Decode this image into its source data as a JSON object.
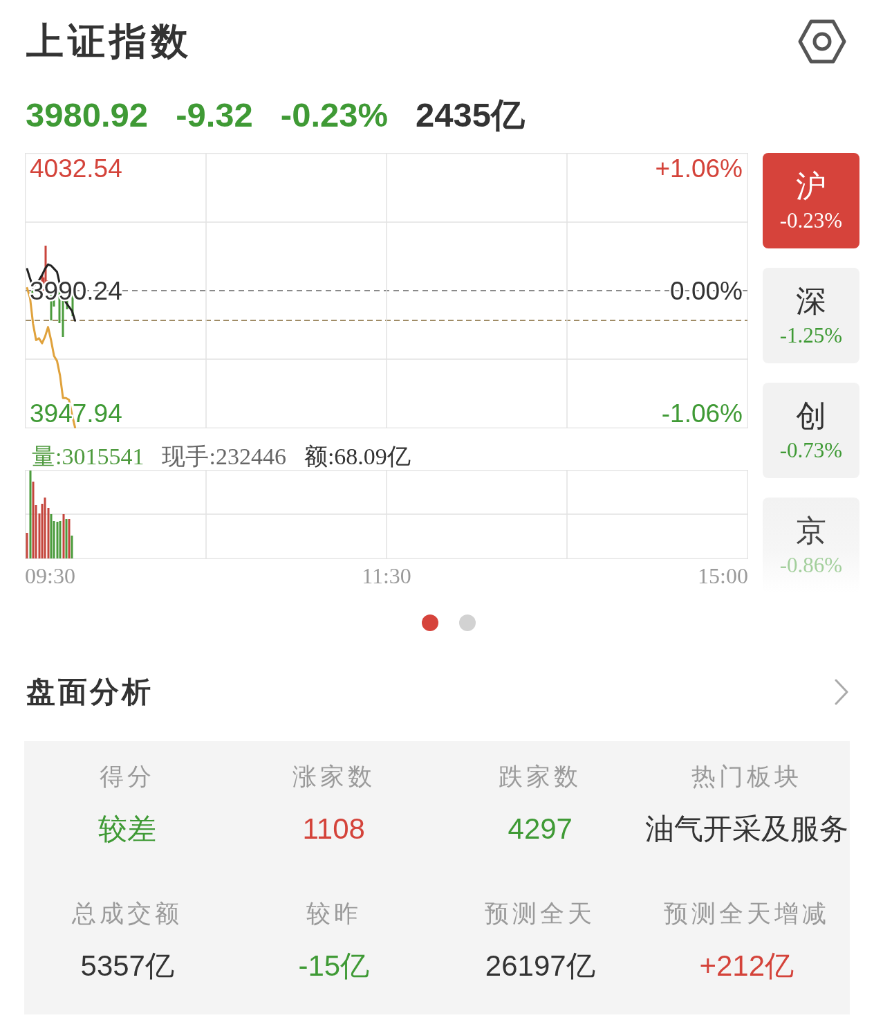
{
  "header": {
    "title": "上证指数"
  },
  "quote": [
    {
      "text": "3980.92",
      "color": "#3f9a35"
    },
    {
      "text": "-9.32",
      "color": "#3f9a35"
    },
    {
      "text": "-0.23%",
      "color": "#3f9a35"
    },
    {
      "text": "2435亿",
      "color": "#333333"
    }
  ],
  "price_chart": {
    "chart_data": {
      "type": "line",
      "categories": [
        null,
        null,
        null,
        null,
        null,
        null,
        null,
        null,
        null,
        null,
        null,
        null,
        null,
        null,
        null,
        null,
        null,
        null,
        null,
        null,
        null,
        null,
        null,
        null,
        null,
        null,
        null,
        null,
        null,
        null,
        null,
        null,
        null,
        null,
        null,
        null,
        null,
        null,
        null,
        null,
        null,
        null,
        null,
        null,
        null,
        null,
        null,
        null,
        null,
        null,
        null,
        null,
        null,
        null,
        null,
        null,
        null,
        null,
        null,
        null,
        null,
        null,
        null,
        null,
        null,
        null,
        null,
        null,
        null,
        null,
        null,
        null,
        null,
        null,
        null,
        null,
        null,
        null,
        null,
        null,
        null,
        null,
        null,
        null,
        null,
        null,
        null,
        null,
        null,
        null,
        null,
        null,
        null,
        null,
        null,
        null,
        null,
        null,
        null,
        null,
        null,
        null,
        null,
        null,
        null,
        null,
        null,
        null,
        null,
        null,
        null,
        null,
        null,
        null,
        null,
        null,
        null,
        null,
        null,
        null,
        null,
        null,
        null,
        null,
        null,
        null,
        null,
        null,
        null,
        null,
        null,
        null,
        null,
        null,
        null,
        null,
        null,
        null,
        null,
        null,
        null,
        null,
        null,
        null,
        null,
        null,
        null,
        null,
        null,
        null,
        null,
        null,
        null,
        null,
        null,
        null,
        null,
        null,
        null,
        null,
        null,
        null,
        null,
        null,
        null,
        null,
        null,
        null,
        null,
        null,
        null,
        null,
        null,
        null,
        null,
        null,
        null,
        null,
        null,
        null,
        null,
        null,
        null,
        null,
        null,
        null,
        null,
        null,
        null,
        null,
        null,
        null,
        null,
        null,
        null,
        null,
        null,
        null,
        null,
        null,
        null,
        null,
        null,
        null,
        null,
        null,
        null,
        null,
        null,
        null,
        null,
        null,
        null,
        null,
        null,
        null,
        null,
        null,
        null,
        null,
        null,
        null,
        null,
        null,
        null,
        null,
        null,
        null,
        null,
        null,
        null,
        null,
        null,
        null,
        null,
        null,
        null,
        null,
        null,
        null,
        null
      ],
      "series": [
        {
          "color": "#222222",
          "values": [
            3997.7,
            3994.4,
            3991.4,
            3992.8,
            3993.9,
            3995.6,
            3997.8,
            3999.3,
            3998.9,
            3997.8,
            3996.7,
            3992.2,
            3988.3,
            3986.1,
            3984.7,
            3983.3,
            3979.9,
            null,
            null,
            null,
            null,
            null,
            null,
            null,
            null,
            null,
            null,
            null,
            null,
            null,
            null,
            null,
            null,
            null,
            null,
            null,
            null,
            null,
            null,
            null,
            null,
            null,
            null,
            null,
            null,
            null,
            null,
            null,
            null,
            null,
            null,
            null,
            null,
            null,
            null,
            null,
            null,
            null,
            null,
            null,
            null,
            null,
            null,
            null,
            null,
            null,
            null,
            null,
            null,
            null,
            null,
            null,
            null,
            null,
            null,
            null,
            null,
            null,
            null,
            null,
            null,
            null,
            null,
            null,
            null,
            null,
            null,
            null,
            null,
            null,
            null,
            null,
            null,
            null,
            null,
            null,
            null,
            null,
            null,
            null,
            null,
            null,
            null,
            null,
            null,
            null,
            null,
            null,
            null,
            null,
            null,
            null,
            null,
            null,
            null,
            null,
            null,
            null,
            null,
            null,
            null,
            null,
            null,
            null,
            null,
            null,
            null,
            null,
            null,
            null,
            null,
            null,
            null,
            null,
            null,
            null,
            null,
            null,
            null,
            null,
            null,
            null,
            null,
            null,
            null,
            null,
            null,
            null,
            null,
            null,
            null,
            null,
            null,
            null,
            null,
            null,
            null,
            null,
            null,
            null,
            null,
            null,
            null,
            null,
            null,
            null,
            null,
            null,
            null,
            null,
            null,
            null,
            null,
            null,
            null,
            null,
            null,
            null,
            null,
            null,
            null,
            null,
            null,
            null,
            null,
            null,
            null,
            null,
            null,
            null,
            null,
            null,
            null,
            null,
            null,
            null,
            null,
            null,
            null,
            null,
            null,
            null,
            null,
            null,
            null,
            null,
            null,
            null,
            null,
            null,
            null,
            null,
            null,
            null,
            null,
            null,
            null,
            null,
            null,
            null,
            null,
            null,
            null,
            null,
            null,
            null,
            null,
            null,
            null,
            null,
            null,
            null,
            null,
            null,
            null,
            null,
            null,
            null,
            null,
            null,
            null
          ]
        },
        {
          "color": "#e0a23c",
          "values": [
            3991.1,
            3987.7,
            3978.8,
            3973.2,
            3973.8,
            3972.1,
            3974.4,
            3977.7,
            3973.2,
            3967.7,
            3966,
            3961,
            3953.2,
            3953.2,
            3952.6,
            3947.6,
            3943.1,
            null,
            null,
            null,
            null,
            null,
            null,
            null,
            null,
            null,
            null,
            null,
            null,
            null,
            null,
            null,
            null,
            null,
            null,
            null,
            null,
            null,
            null,
            null,
            null,
            null,
            null,
            null,
            null,
            null,
            null,
            null,
            null,
            null,
            null,
            null,
            null,
            null,
            null,
            null,
            null,
            null,
            null,
            null,
            null,
            null,
            null,
            null,
            null,
            null,
            null,
            null,
            null,
            null,
            null,
            null,
            null,
            null,
            null,
            null,
            null,
            null,
            null,
            null,
            null,
            null,
            null,
            null,
            null,
            null,
            null,
            null,
            null,
            null,
            null,
            null,
            null,
            null,
            null,
            null,
            null,
            null,
            null,
            null,
            null,
            null,
            null,
            null,
            null,
            null,
            null,
            null,
            null,
            null,
            null,
            null,
            null,
            null,
            null,
            null,
            null,
            null,
            null,
            null,
            null,
            null,
            null,
            null,
            null,
            null,
            null,
            null,
            null,
            null,
            null,
            null,
            null,
            null,
            null,
            null,
            null,
            null,
            null,
            null,
            null,
            null,
            null,
            null,
            null,
            null,
            null,
            null,
            null,
            null,
            null,
            null,
            null,
            null,
            null,
            null,
            null,
            null,
            null,
            null,
            null,
            null,
            null,
            null,
            null,
            null,
            null,
            null,
            null,
            null,
            null,
            null,
            null,
            null,
            null,
            null,
            null,
            null,
            null,
            null,
            null,
            null,
            null,
            null,
            null,
            null,
            null,
            null,
            null,
            null,
            null,
            null,
            null,
            null,
            null,
            null,
            null,
            null,
            null,
            null,
            null,
            null,
            null,
            null,
            null,
            null,
            null,
            null,
            null,
            null,
            null,
            null,
            null,
            null,
            null,
            null,
            null,
            null,
            null,
            null,
            null,
            null,
            null,
            null,
            null,
            null,
            null,
            null,
            null,
            null,
            null,
            null,
            null,
            null,
            null,
            null,
            null,
            null,
            null,
            null,
            null
          ]
        }
      ],
      "ylim": [
        3943,
        4037.5
      ],
      "yticks": [
        {
          "value": 4032.54,
          "label": "4032.54"
        },
        {
          "value": 3990.24,
          "label": "3990.24"
        },
        {
          "value": 3947.94,
          "label": "3947.94"
        }
      ]
    },
    "percent_labels": [
      {
        "text": "+1.06%",
        "color": "#d4433a"
      },
      {
        "text": "0.00%",
        "color": "#333333"
      },
      {
        "text": "-1.06%",
        "color": "#3f9a35"
      }
    ]
  },
  "volume_info": [
    {
      "text": "量:3015541",
      "color": "#4e9a3e"
    },
    {
      "text": "现手:232446",
      "color": "#666666"
    },
    {
      "text": "额:68.09亿",
      "color": "#333333"
    }
  ],
  "time_axis": [
    "09:30",
    "11:30",
    "15:00"
  ],
  "market_tabs": [
    {
      "label": "沪",
      "change": "-0.23%",
      "selected": true
    },
    {
      "label": "深",
      "change": "-1.25%",
      "color": "#3f9a35",
      "selected": false
    },
    {
      "label": "创",
      "change": "-0.73%",
      "color": "#3f9a35",
      "selected": false
    },
    {
      "label": "京",
      "change": "-0.86%",
      "color": "#a3cf9c",
      "selected": false
    }
  ],
  "page_dots": [
    {
      "selected": true
    },
    {
      "selected": false
    }
  ],
  "analysis": {
    "title": "盘面分析",
    "stats": [
      {
        "label": "得分",
        "value": "较差",
        "color": "#3f9a35"
      },
      {
        "label": "涨家数",
        "value": "1108",
        "color": "#d4433a"
      },
      {
        "label": "跌家数",
        "value": "4297",
        "color": "#3f9a35"
      },
      {
        "label": "热门板块",
        "value": "油气开采及服务",
        "color": "#333333"
      },
      {
        "label": "总成交额",
        "value": "5357亿",
        "color": "#333333"
      },
      {
        "label": "较昨",
        "value": "-15亿",
        "color": "#3f9a35"
      },
      {
        "label": "预测全天",
        "value": "26197亿",
        "color": "#333333"
      },
      {
        "label": "预测全天增减",
        "value": "+212亿",
        "color": "#d4433a"
      }
    ]
  }
}
